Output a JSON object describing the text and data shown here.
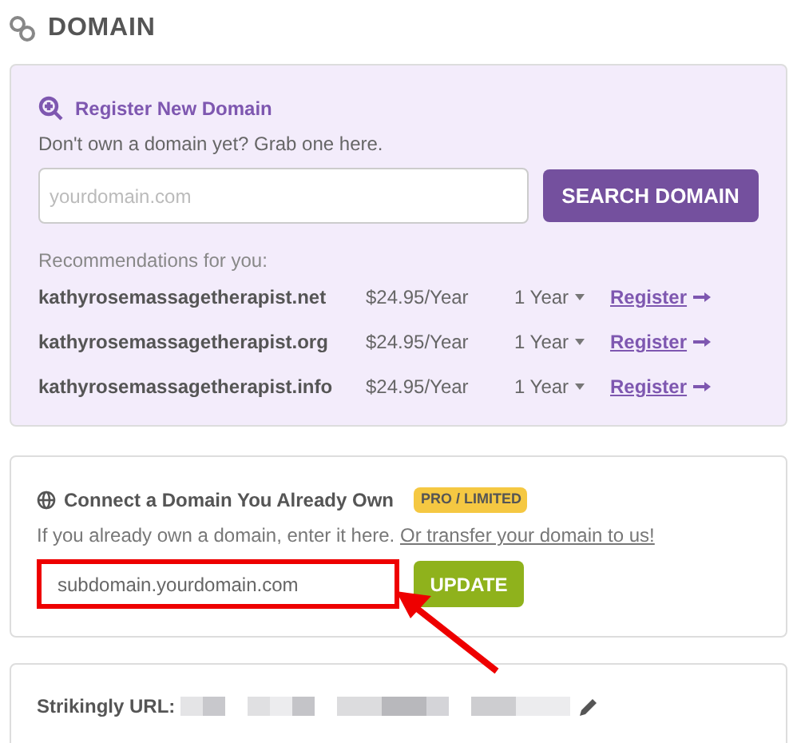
{
  "title": "DOMAIN",
  "register": {
    "title": "Register New Domain",
    "subtitle": "Don't own a domain yet? Grab one here.",
    "search": {
      "placeholder": "yourdomain.com"
    },
    "button": "SEARCH DOMAIN",
    "recommendations_label": "Recommendations for you:",
    "rows": [
      {
        "domain": "kathyrosemassagetherapist.net",
        "price": "$24.95/Year",
        "term": "1 Year",
        "action": "Register"
      },
      {
        "domain": "kathyrosemassagetherapist.org",
        "price": "$24.95/Year",
        "term": "1 Year",
        "action": "Register"
      },
      {
        "domain": "kathyrosemassagetherapist.info",
        "price": "$24.95/Year",
        "term": "1 Year",
        "action": "Register"
      }
    ]
  },
  "connect": {
    "title": "Connect a Domain You Already Own",
    "badge": "PRO / LIMITED",
    "text": "If you already own a domain, enter it here.",
    "link": "Or transfer your domain to us!",
    "field": {
      "value": "subdomain.yourdomain.com",
      "highlighted": true
    },
    "button": "UPDATE"
  },
  "url": {
    "label": "Strikingly URL:"
  }
}
